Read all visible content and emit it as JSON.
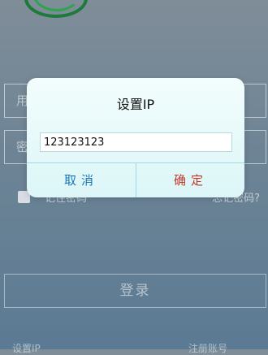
{
  "background": {
    "username_placeholder": "用",
    "password_placeholder": "密",
    "remember_label": "记住密码",
    "forgot_link": "忘记密码?",
    "login_button": "登录",
    "footer_left": "设置IP",
    "footer_right": "注册账号"
  },
  "dialog": {
    "title": "设置IP",
    "ip_value": "123123123",
    "cancel_label": "取消",
    "confirm_label": "确定"
  },
  "colors": {
    "cancel": "#1a73b8",
    "confirm": "#c0392b",
    "dialog_bg": "#e6f8f9"
  }
}
